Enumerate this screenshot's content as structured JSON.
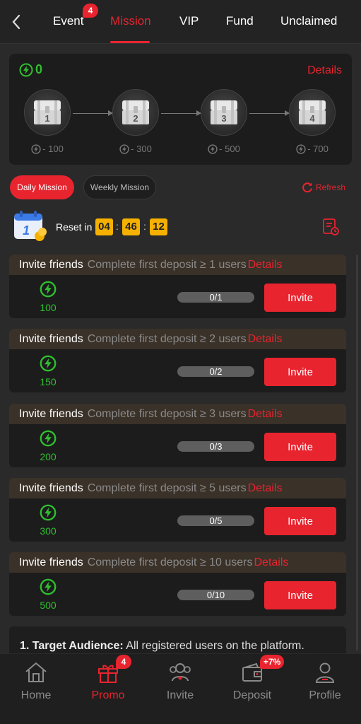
{
  "header": {
    "tabs": [
      {
        "label": "Event",
        "badge": "4"
      },
      {
        "label": "Mission",
        "active": true
      },
      {
        "label": "VIP"
      },
      {
        "label": "Fund"
      },
      {
        "label": "Unclaimed"
      }
    ]
  },
  "chests": {
    "energy": "0",
    "details_label": "Details",
    "items": [
      {
        "number": "1",
        "requirement": "- 100"
      },
      {
        "number": "2",
        "requirement": "- 300"
      },
      {
        "number": "3",
        "requirement": "- 500"
      },
      {
        "number": "4",
        "requirement": "- 700"
      }
    ]
  },
  "mission_tabs": {
    "daily": "Daily Mission",
    "weekly": "Weekly Mission",
    "refresh": "Refresh"
  },
  "reset": {
    "label": "Reset in",
    "hours": "04",
    "minutes": "46",
    "seconds": "12"
  },
  "missions": [
    {
      "title": "Invite friends",
      "desc": "Complete first deposit ≥ 1 users",
      "details": "Details",
      "reward": "100",
      "progress": "0/1",
      "button": "Invite"
    },
    {
      "title": "Invite friends",
      "desc": "Complete first deposit ≥ 2 users",
      "details": "Details",
      "reward": "150",
      "progress": "0/2",
      "button": "Invite"
    },
    {
      "title": "Invite friends",
      "desc": "Complete first deposit ≥ 3 users",
      "details": "Details",
      "reward": "200",
      "progress": "0/3",
      "button": "Invite"
    },
    {
      "title": "Invite friends",
      "desc": "Complete first deposit ≥ 5 users",
      "details": "Details",
      "reward": "300",
      "progress": "0/5",
      "button": "Invite"
    },
    {
      "title": "Invite friends",
      "desc": "Complete first deposit ≥ 10 users",
      "details": "Details",
      "reward": "500",
      "progress": "0/10",
      "button": "Invite"
    }
  ],
  "terms": {
    "heading": "1. Target Audience:",
    "text": " All registered users on the platform."
  },
  "bottom_nav": {
    "items": [
      {
        "label": "Home",
        "icon": "home-icon"
      },
      {
        "label": "Promo",
        "icon": "gift-icon",
        "active": true,
        "badge": "4"
      },
      {
        "label": "Invite",
        "icon": "users-icon"
      },
      {
        "label": "Deposit",
        "icon": "wallet-icon",
        "badge": "+7%"
      },
      {
        "label": "Profile",
        "icon": "profile-icon"
      }
    ]
  },
  "colors": {
    "accent": "#e8242f",
    "energy": "#2fbf2f",
    "timer": "#f6b100",
    "background": "#2a2a2a"
  }
}
